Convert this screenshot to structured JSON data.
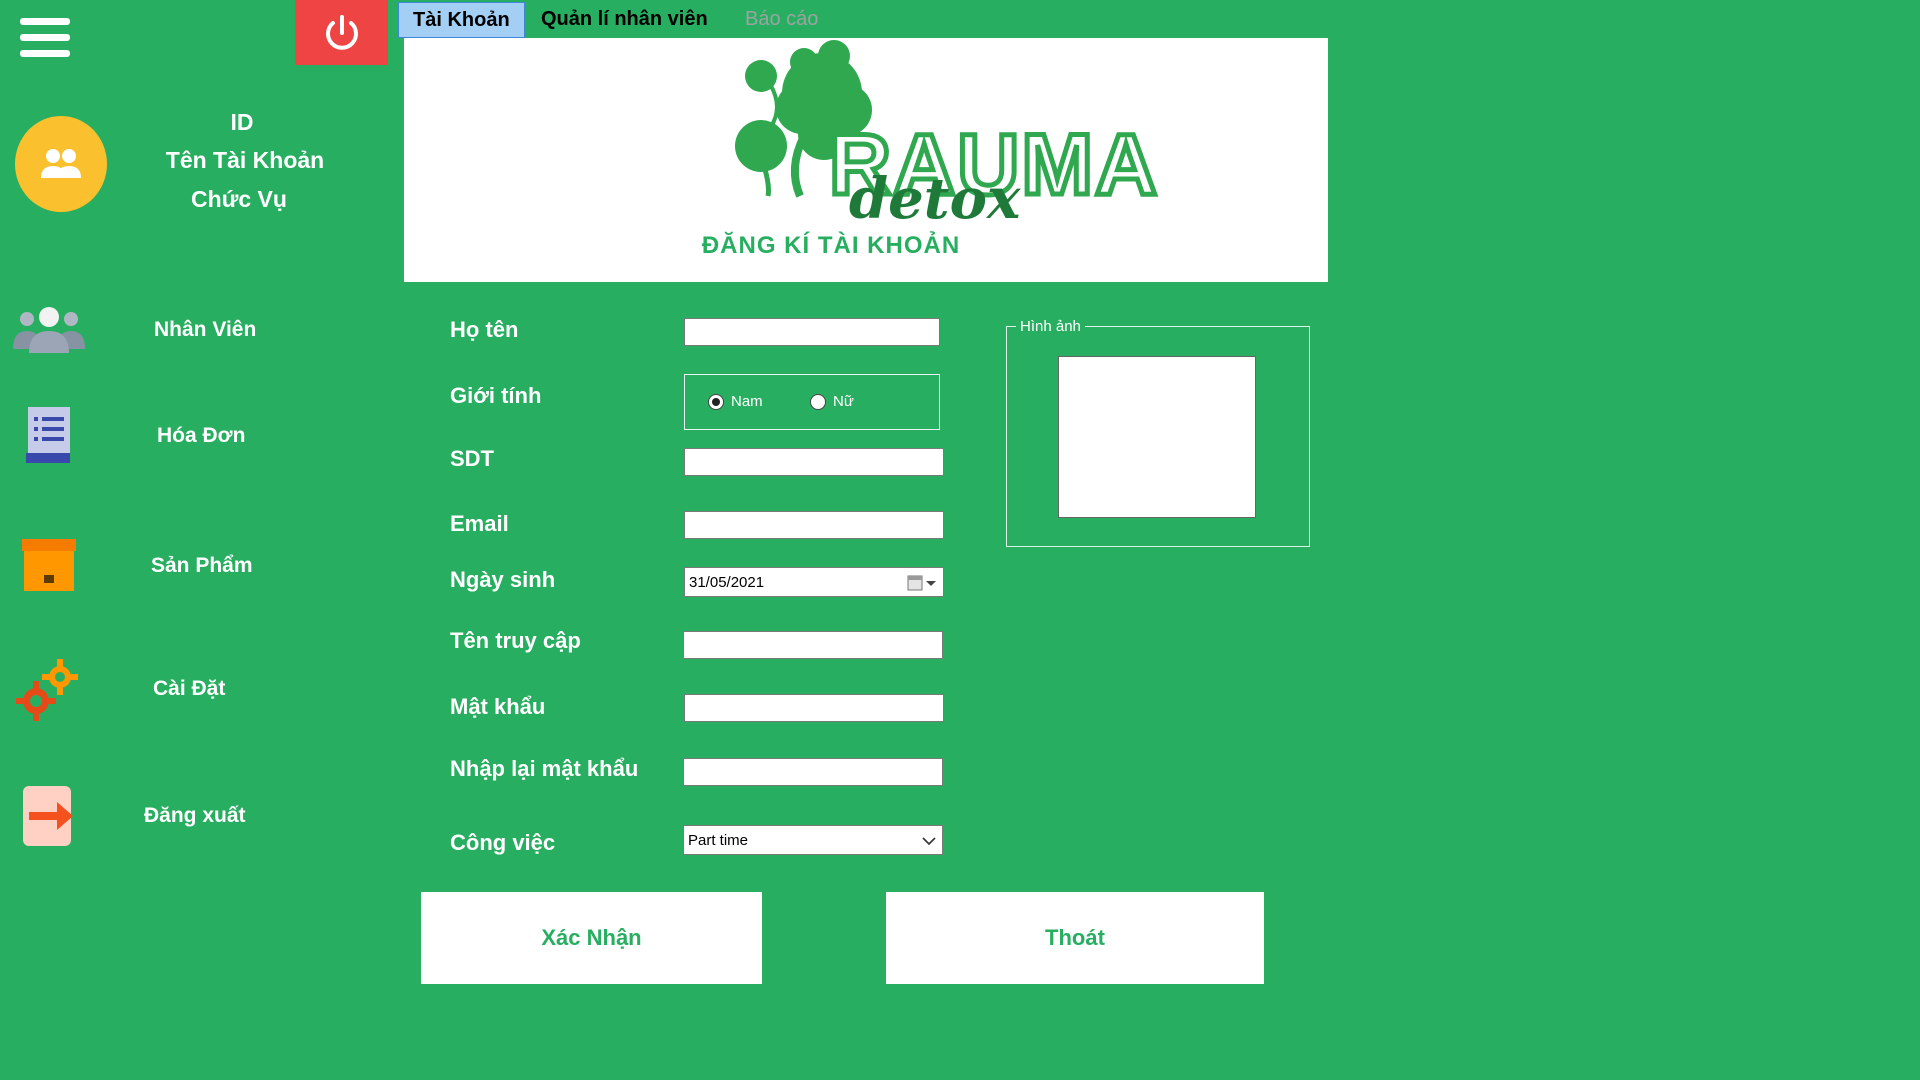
{
  "user": {
    "id_label": "ID",
    "name_label": "Tên Tài Khoản",
    "role_label": "Chức Vụ"
  },
  "sidebar": {
    "items": [
      {
        "label": "Nhân Viên",
        "icon": "people-icon"
      },
      {
        "label": "Hóa Đơn",
        "icon": "invoice-icon"
      },
      {
        "label": "Sản Phẩm",
        "icon": "box-icon"
      },
      {
        "label": "Cài Đặt",
        "icon": "gear-icon"
      },
      {
        "label": "Đăng xuất",
        "icon": "logout-icon"
      }
    ]
  },
  "tabs": [
    {
      "label": "Tài Khoản",
      "active": true
    },
    {
      "label": "Quản lí nhân viên",
      "active": false
    },
    {
      "label": "Báo cáo",
      "active": false
    }
  ],
  "banner": {
    "brand": "RAUMA",
    "brand_script": "detox",
    "title": "ĐĂNG KÍ TÀI KHOẢN"
  },
  "form": {
    "fullname_label": "Họ tên",
    "gender_label": "Giới tính",
    "gender_male": "Nam",
    "gender_female": "Nữ",
    "phone_label": "SDT",
    "email_label": "Email",
    "birthday_label": "Ngày sinh",
    "birthday_value": "31/05/2021",
    "username_label": "Tên truy cập",
    "password_label": "Mật khẩu",
    "confirm_label": "Nhập lại mật khẩu",
    "job_label": "Công việc",
    "job_value": "Part time"
  },
  "photo": {
    "legend": "Hình ảnh"
  },
  "buttons": {
    "confirm": "Xác Nhận",
    "exit": "Thoát"
  },
  "colors": {
    "background": "#28ae60",
    "power": "#ef4444",
    "avatar": "#fbc02d",
    "tab_active": "#a4cff4"
  }
}
